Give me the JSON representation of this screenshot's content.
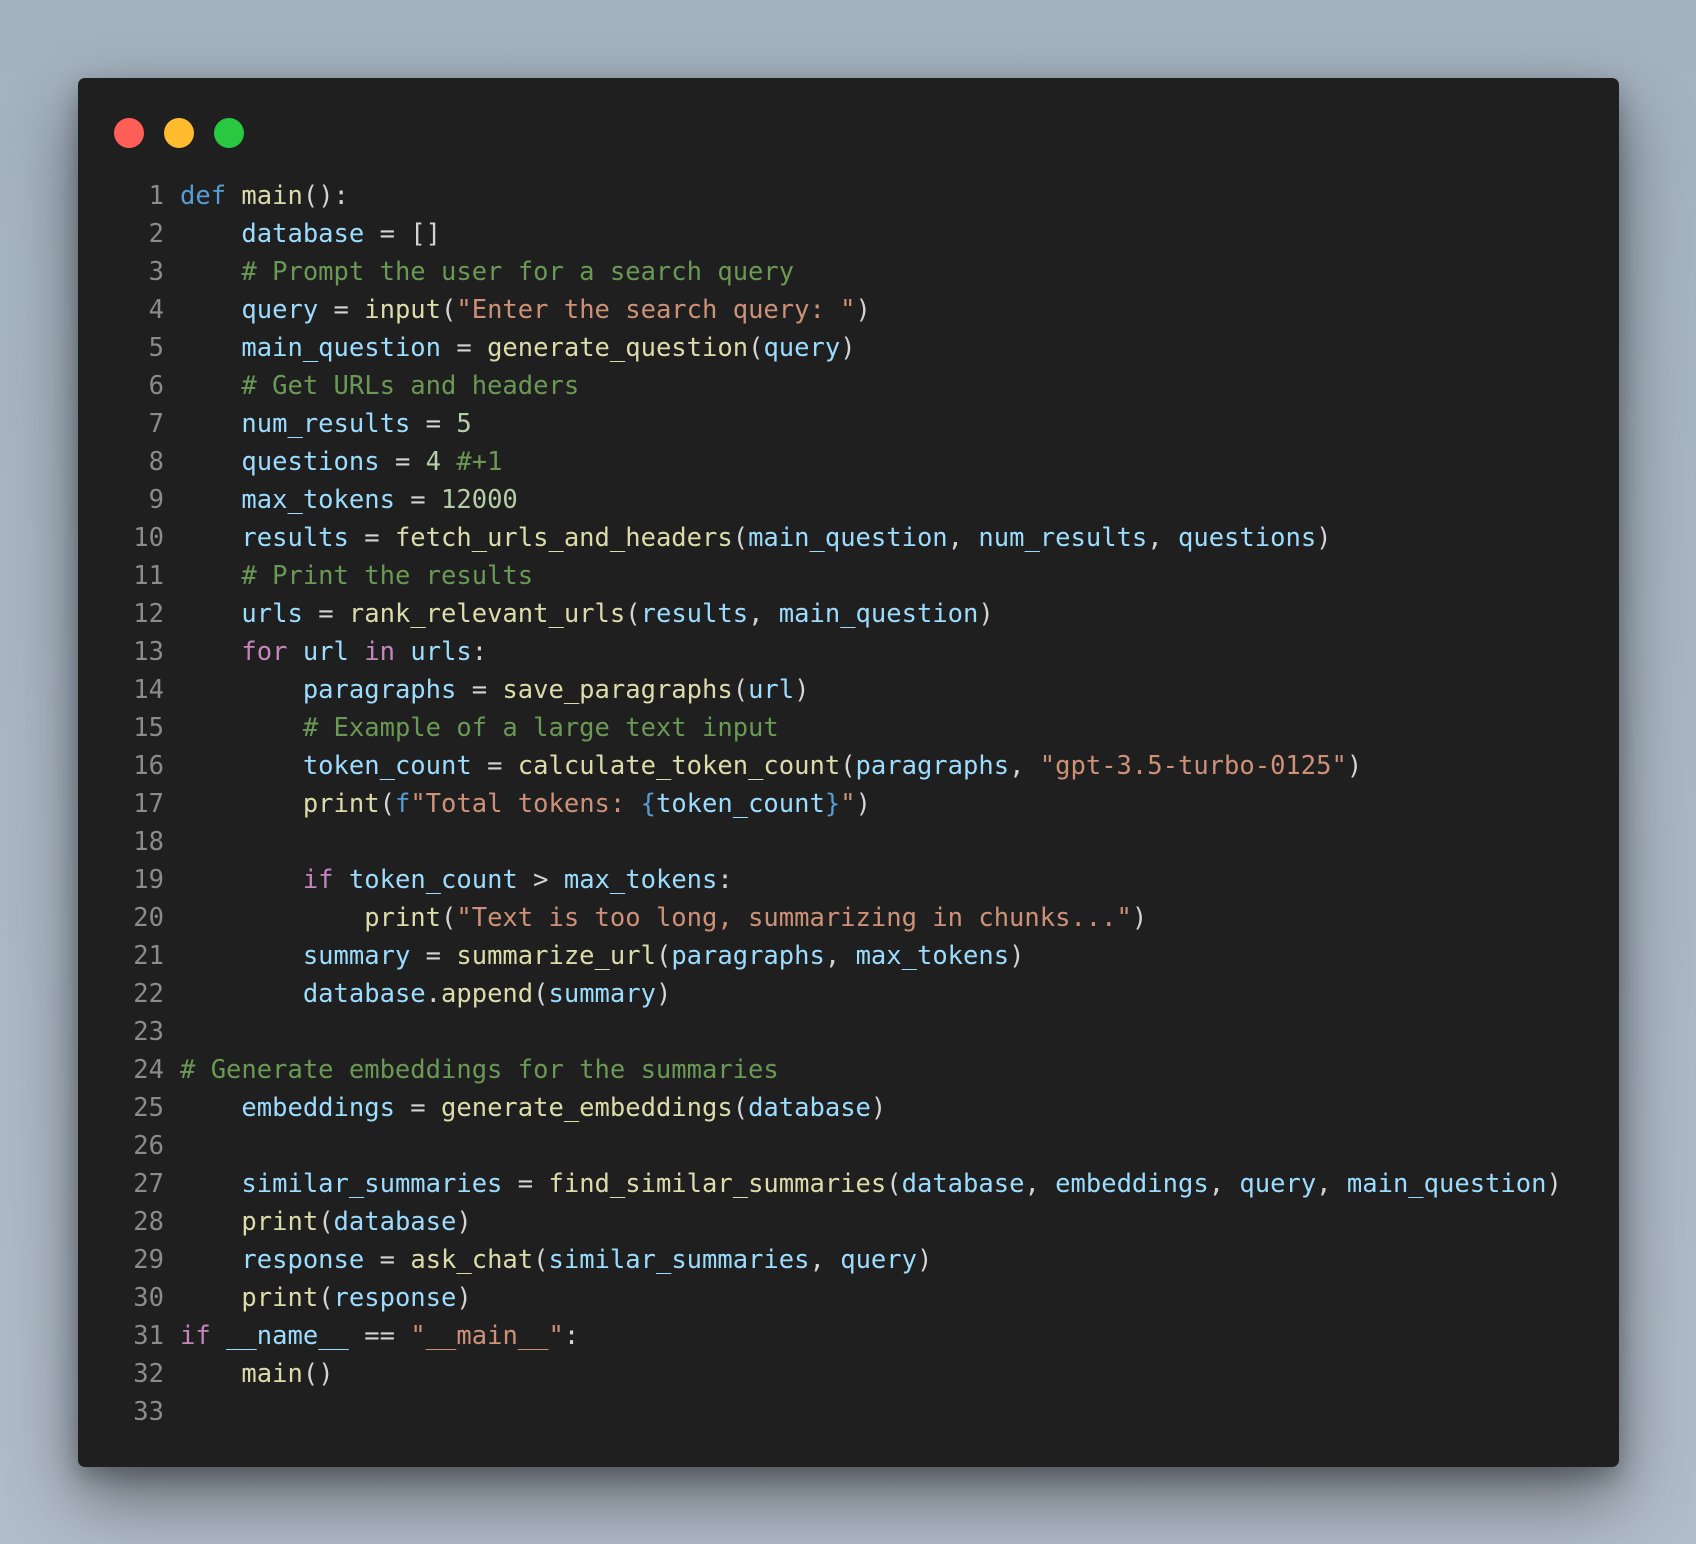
{
  "window": {
    "controls": {
      "close": "red",
      "minimize": "yellow",
      "maximize": "green"
    }
  },
  "colors": {
    "background": "#1f1f1f",
    "keyword": "#569cd6",
    "control": "#c586c0",
    "function": "#dcdcaa",
    "variable": "#9cdcfe",
    "string": "#ce9178",
    "number": "#b5cea8",
    "comment": "#6a9955",
    "line_number": "#8b8b8b"
  },
  "code": {
    "language": "python",
    "lines": [
      [
        [
          "kw",
          "def"
        ],
        [
          "op",
          " "
        ],
        [
          "fn",
          "main"
        ],
        [
          "op",
          "():"
        ]
      ],
      [
        [
          "op",
          "    "
        ],
        [
          "var",
          "database"
        ],
        [
          "op",
          " = []"
        ]
      ],
      [
        [
          "op",
          "    "
        ],
        [
          "cm",
          "# Prompt the user for a search query"
        ]
      ],
      [
        [
          "op",
          "    "
        ],
        [
          "var",
          "query"
        ],
        [
          "op",
          " = "
        ],
        [
          "fn",
          "input"
        ],
        [
          "op",
          "("
        ],
        [
          "str",
          "\"Enter the search query: \""
        ],
        [
          "op",
          ")"
        ]
      ],
      [
        [
          "op",
          "    "
        ],
        [
          "var",
          "main_question"
        ],
        [
          "op",
          " = "
        ],
        [
          "fn",
          "generate_question"
        ],
        [
          "op",
          "("
        ],
        [
          "var",
          "query"
        ],
        [
          "op",
          ")"
        ]
      ],
      [
        [
          "op",
          "    "
        ],
        [
          "cm",
          "# Get URLs and headers"
        ]
      ],
      [
        [
          "op",
          "    "
        ],
        [
          "var",
          "num_results"
        ],
        [
          "op",
          " = "
        ],
        [
          "num",
          "5"
        ]
      ],
      [
        [
          "op",
          "    "
        ],
        [
          "var",
          "questions"
        ],
        [
          "op",
          " = "
        ],
        [
          "num",
          "4"
        ],
        [
          "op",
          " "
        ],
        [
          "cm",
          "#+1"
        ]
      ],
      [
        [
          "op",
          "    "
        ],
        [
          "var",
          "max_tokens"
        ],
        [
          "op",
          " = "
        ],
        [
          "num",
          "12000"
        ]
      ],
      [
        [
          "op",
          "    "
        ],
        [
          "var",
          "results"
        ],
        [
          "op",
          " = "
        ],
        [
          "fn",
          "fetch_urls_and_headers"
        ],
        [
          "op",
          "("
        ],
        [
          "var",
          "main_question"
        ],
        [
          "op",
          ", "
        ],
        [
          "var",
          "num_results"
        ],
        [
          "op",
          ", "
        ],
        [
          "var",
          "questions"
        ],
        [
          "op",
          ")"
        ]
      ],
      [
        [
          "op",
          "    "
        ],
        [
          "cm",
          "# Print the results"
        ]
      ],
      [
        [
          "op",
          "    "
        ],
        [
          "var",
          "urls"
        ],
        [
          "op",
          " = "
        ],
        [
          "fn",
          "rank_relevant_urls"
        ],
        [
          "op",
          "("
        ],
        [
          "var",
          "results"
        ],
        [
          "op",
          ", "
        ],
        [
          "var",
          "main_question"
        ],
        [
          "op",
          ")"
        ]
      ],
      [
        [
          "op",
          "    "
        ],
        [
          "ctl",
          "for"
        ],
        [
          "op",
          " "
        ],
        [
          "var",
          "url"
        ],
        [
          "op",
          " "
        ],
        [
          "ctl",
          "in"
        ],
        [
          "op",
          " "
        ],
        [
          "var",
          "urls"
        ],
        [
          "op",
          ":"
        ]
      ],
      [
        [
          "op",
          "        "
        ],
        [
          "var",
          "paragraphs"
        ],
        [
          "op",
          " = "
        ],
        [
          "fn",
          "save_paragraphs"
        ],
        [
          "op",
          "("
        ],
        [
          "var",
          "url"
        ],
        [
          "op",
          ")"
        ]
      ],
      [
        [
          "op",
          "        "
        ],
        [
          "cm",
          "# Example of a large text input"
        ]
      ],
      [
        [
          "op",
          "        "
        ],
        [
          "var",
          "token_count"
        ],
        [
          "op",
          " = "
        ],
        [
          "fn",
          "calculate_token_count"
        ],
        [
          "op",
          "("
        ],
        [
          "var",
          "paragraphs"
        ],
        [
          "op",
          ", "
        ],
        [
          "str",
          "\"gpt-3.5-turbo-0125\""
        ],
        [
          "op",
          ")"
        ]
      ],
      [
        [
          "op",
          "        "
        ],
        [
          "fn",
          "print"
        ],
        [
          "op",
          "("
        ],
        [
          "kw",
          "f"
        ],
        [
          "str",
          "\"Total tokens: "
        ],
        [
          "kw",
          "{"
        ],
        [
          "var",
          "token_count"
        ],
        [
          "kw",
          "}"
        ],
        [
          "str",
          "\""
        ],
        [
          "op",
          ")"
        ]
      ],
      [],
      [
        [
          "op",
          "        "
        ],
        [
          "ctl",
          "if"
        ],
        [
          "op",
          " "
        ],
        [
          "var",
          "token_count"
        ],
        [
          "op",
          " > "
        ],
        [
          "var",
          "max_tokens"
        ],
        [
          "op",
          ":"
        ]
      ],
      [
        [
          "op",
          "            "
        ],
        [
          "fn",
          "print"
        ],
        [
          "op",
          "("
        ],
        [
          "str",
          "\"Text is too long, summarizing in chunks...\""
        ],
        [
          "op",
          ")"
        ]
      ],
      [
        [
          "op",
          "        "
        ],
        [
          "var",
          "summary"
        ],
        [
          "op",
          " = "
        ],
        [
          "fn",
          "summarize_url"
        ],
        [
          "op",
          "("
        ],
        [
          "var",
          "paragraphs"
        ],
        [
          "op",
          ", "
        ],
        [
          "var",
          "max_tokens"
        ],
        [
          "op",
          ")"
        ]
      ],
      [
        [
          "op",
          "        "
        ],
        [
          "var",
          "database"
        ],
        [
          "op",
          "."
        ],
        [
          "fn",
          "append"
        ],
        [
          "op",
          "("
        ],
        [
          "var",
          "summary"
        ],
        [
          "op",
          ")"
        ]
      ],
      [],
      [
        [
          "cm",
          "# Generate embeddings for the summaries"
        ]
      ],
      [
        [
          "op",
          "    "
        ],
        [
          "var",
          "embeddings"
        ],
        [
          "op",
          " = "
        ],
        [
          "fn",
          "generate_embeddings"
        ],
        [
          "op",
          "("
        ],
        [
          "var",
          "database"
        ],
        [
          "op",
          ")"
        ]
      ],
      [],
      [
        [
          "op",
          "    "
        ],
        [
          "var",
          "similar_summaries"
        ],
        [
          "op",
          " = "
        ],
        [
          "fn",
          "find_similar_summaries"
        ],
        [
          "op",
          "("
        ],
        [
          "var",
          "database"
        ],
        [
          "op",
          ", "
        ],
        [
          "var",
          "embeddings"
        ],
        [
          "op",
          ", "
        ],
        [
          "var",
          "query"
        ],
        [
          "op",
          ", "
        ],
        [
          "var",
          "main_question"
        ],
        [
          "op",
          ")"
        ]
      ],
      [
        [
          "op",
          "    "
        ],
        [
          "fn",
          "print"
        ],
        [
          "op",
          "("
        ],
        [
          "var",
          "database"
        ],
        [
          "op",
          ")"
        ]
      ],
      [
        [
          "op",
          "    "
        ],
        [
          "var",
          "response"
        ],
        [
          "op",
          " = "
        ],
        [
          "fn",
          "ask_chat"
        ],
        [
          "op",
          "("
        ],
        [
          "var",
          "similar_summaries"
        ],
        [
          "op",
          ", "
        ],
        [
          "var",
          "query"
        ],
        [
          "op",
          ")"
        ]
      ],
      [
        [
          "op",
          "    "
        ],
        [
          "fn",
          "print"
        ],
        [
          "op",
          "("
        ],
        [
          "var",
          "response"
        ],
        [
          "op",
          ")"
        ]
      ],
      [
        [
          "ctl",
          "if"
        ],
        [
          "op",
          " "
        ],
        [
          "var",
          "__name__"
        ],
        [
          "op",
          " == "
        ],
        [
          "str",
          "\"__main__\""
        ],
        [
          "op",
          ":"
        ]
      ],
      [
        [
          "op",
          "    "
        ],
        [
          "fn",
          "main"
        ],
        [
          "op",
          "()"
        ]
      ],
      []
    ]
  }
}
